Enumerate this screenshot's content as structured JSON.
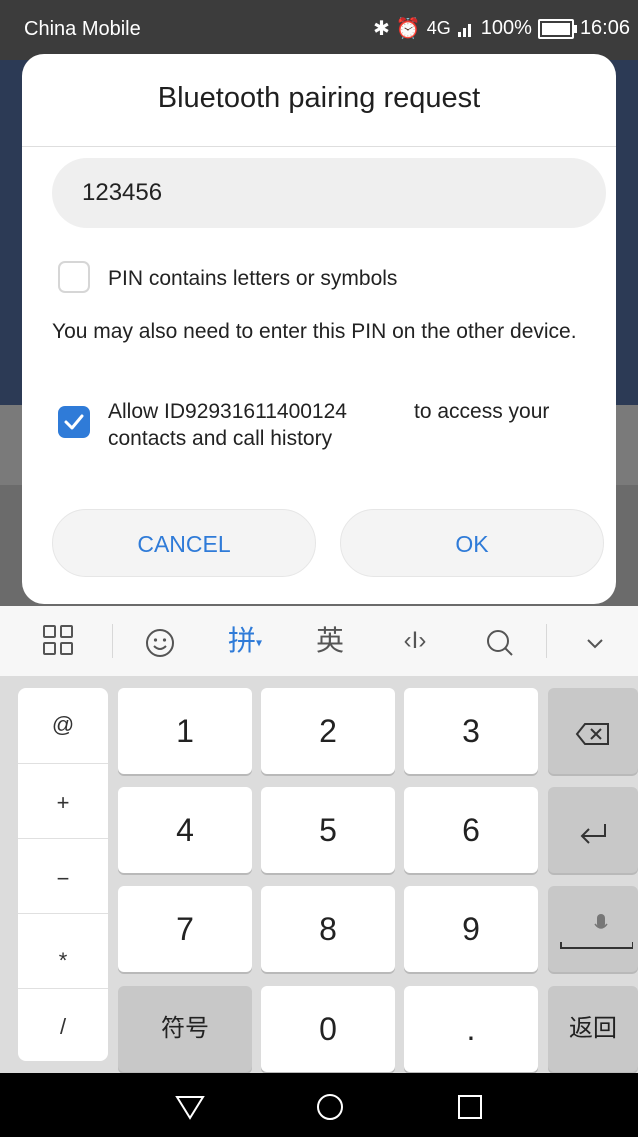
{
  "status_bar": {
    "carrier": "China Mobile",
    "network": "4G",
    "battery": "100%",
    "time": "16:06"
  },
  "dialog": {
    "title": "Bluetooth pairing request",
    "pin_value": "123456",
    "letters_checkbox": {
      "label": "PIN contains letters or symbols",
      "checked": false
    },
    "info_text": "You may also need to enter this PIN on the other device.",
    "allow_checkbox": {
      "label_prefix": "Allow ID92931611400124",
      "label_suffix": "to access your",
      "label_line2": "contacts and call history",
      "checked": true
    },
    "cancel_label": "CANCEL",
    "ok_label": "OK",
    "accent_color": "#2f7bd8"
  },
  "keyboard": {
    "toolbar": {
      "pinyin_label": "拼",
      "english_label": "英",
      "cursor_label": "‹I›"
    },
    "side_keys": [
      "@",
      "+",
      "−",
      "*",
      "/"
    ],
    "digits": [
      "1",
      "2",
      "3",
      "4",
      "5",
      "6",
      "7",
      "8",
      "9",
      "0"
    ],
    "symbols_key": "符号",
    "dot_key": ".",
    "back_key": "返回"
  }
}
